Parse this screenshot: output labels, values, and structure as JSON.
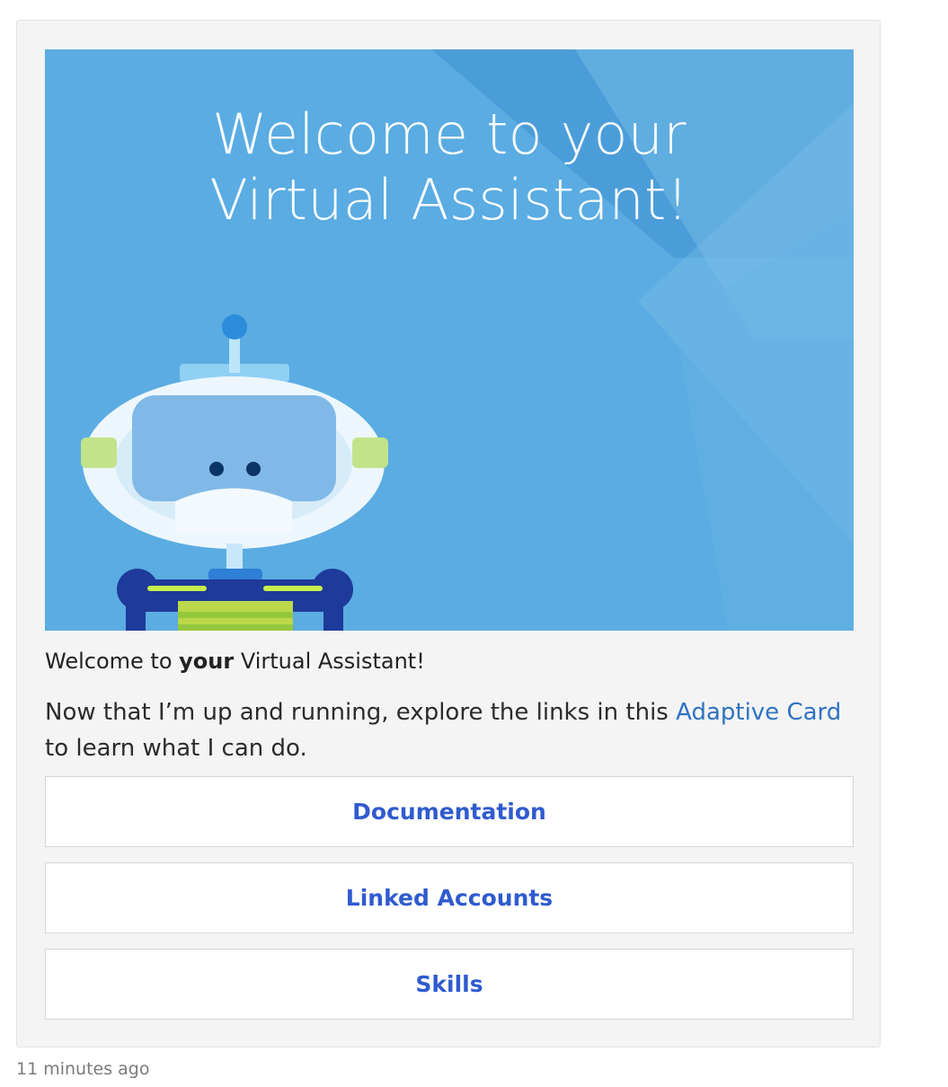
{
  "card": {
    "hero_title_line1": "Welcome to your",
    "hero_title_line2": "Virtual Assistant!",
    "title_prefix": "Welcome to ",
    "title_bold": "your",
    "title_suffix": " Virtual Assistant!",
    "body_prefix": "Now that I’m up and running, explore the links in this ",
    "body_link": "Adaptive Card",
    "body_suffix": " to learn what I can do.",
    "actions": [
      {
        "label": "Documentation"
      },
      {
        "label": "Linked Accounts"
      },
      {
        "label": "Skills"
      }
    ]
  },
  "meta": {
    "timestamp": "11 minutes ago"
  },
  "colors": {
    "hero_background": "#5aace2",
    "link": "#2f73c2",
    "button_text": "#2f5bcf"
  },
  "icons": {
    "hero_graphic": "robot-illustration-icon"
  }
}
